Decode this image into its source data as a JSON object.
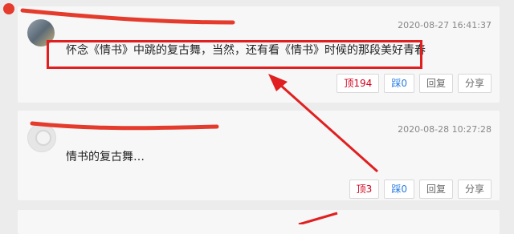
{
  "comments": [
    {
      "time": "2020-08-27 16:41:37",
      "text": "怀念《情书》中跳的复古舞，当然，还有看《情书》时候的那段美好青春",
      "actions": {
        "up_label": "顶",
        "up_count": "194",
        "down_label": "踩",
        "down_count": "0",
        "reply": "回复",
        "share": "分享"
      }
    },
    {
      "time": "2020-08-28 10:27:28",
      "text": "情书的复古舞…",
      "actions": {
        "up_label": "顶",
        "up_count": "3",
        "down_label": "踩",
        "down_count": "0",
        "reply": "回复",
        "share": "分享"
      }
    }
  ],
  "colors": {
    "annotation": "#e02020",
    "up": "#d0021b",
    "down": "#2b7de0"
  }
}
